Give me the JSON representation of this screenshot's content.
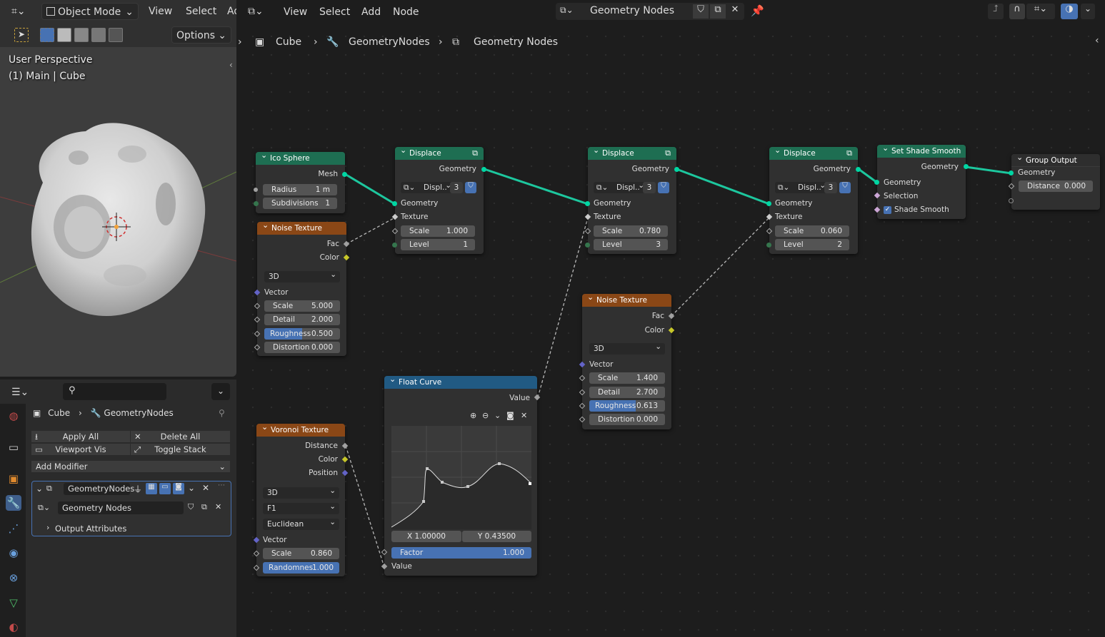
{
  "viewport": {
    "mode": "Object Mode",
    "menu": [
      "View",
      "Select",
      "Ad"
    ],
    "options": "Options",
    "perspective": "User Perspective",
    "object": "(1) Main | Cube"
  },
  "properties": {
    "breadcrumb": [
      "Cube",
      "GeometryNodes"
    ],
    "apply_all": "Apply All",
    "delete_all": "Delete All",
    "viewport_vis": "Viewport Vis",
    "toggle_stack": "Toggle Stack",
    "add_modifier": "Add Modifier",
    "modifier_name": "GeometryNodes",
    "node_group": "Geometry Nodes",
    "output_attributes": "Output Attributes"
  },
  "editor": {
    "menu": [
      "View",
      "Select",
      "Add",
      "Node"
    ],
    "node_group": "Geometry Nodes",
    "breadcrumb": [
      "Cube",
      "GeometryNodes",
      "Geometry Nodes"
    ]
  },
  "nodes": {
    "ico": {
      "title": "Ico Sphere",
      "mesh": "Mesh",
      "radius_l": "Radius",
      "radius_v": "1 m",
      "subdiv_l": "Subdivisions",
      "subdiv_v": "1"
    },
    "noise1": {
      "title": "Noise Texture",
      "fac": "Fac",
      "color": "Color",
      "dim": "3D",
      "vector": "Vector",
      "scale_l": "Scale",
      "scale_v": "5.000",
      "detail_l": "Detail",
      "detail_v": "2.000",
      "rough_l": "Roughness",
      "rough_v": "0.500",
      "dist_l": "Distortion",
      "dist_v": "0.000"
    },
    "disp1": {
      "title": "Displace",
      "geo_out": "Geometry",
      "name": "Displ..",
      "users": "3",
      "geo_in": "Geometry",
      "tex": "Texture",
      "scale_l": "Scale",
      "scale_v": "1.000",
      "level_l": "Level",
      "level_v": "1"
    },
    "disp2": {
      "title": "Displace",
      "geo_out": "Geometry",
      "name": "Displ..",
      "users": "3",
      "geo_in": "Geometry",
      "tex": "Texture",
      "scale_l": "Scale",
      "scale_v": "0.780",
      "level_l": "Level",
      "level_v": "3"
    },
    "disp3": {
      "title": "Displace",
      "geo_out": "Geometry",
      "name": "Displ..",
      "users": "3",
      "geo_in": "Geometry",
      "tex": "Texture",
      "scale_l": "Scale",
      "scale_v": "0.060",
      "level_l": "Level",
      "level_v": "2"
    },
    "smooth": {
      "title": "Set Shade Smooth",
      "geo_out": "Geometry",
      "geo_in": "Geometry",
      "selection": "Selection",
      "shade": "Shade Smooth"
    },
    "group_out": {
      "title": "Group Output",
      "geo": "Geometry",
      "dist_l": "Distance",
      "dist_v": "0.000"
    },
    "noise2": {
      "title": "Noise Texture",
      "fac": "Fac",
      "color": "Color",
      "dim": "3D",
      "vector": "Vector",
      "scale_l": "Scale",
      "scale_v": "1.400",
      "detail_l": "Detail",
      "detail_v": "2.700",
      "rough_l": "Roughness",
      "rough_v": "0.613",
      "dist_l": "Distortion",
      "dist_v": "0.000"
    },
    "curve": {
      "title": "Float Curve",
      "value_out": "Value",
      "x": "X 1.00000",
      "y": "Y 0.43500",
      "factor_l": "Factor",
      "factor_v": "1.000",
      "value_in": "Value"
    },
    "voronoi": {
      "title": "Voronoi Texture",
      "distance": "Distance",
      "color": "Color",
      "position": "Position",
      "dim": "3D",
      "feature": "F1",
      "metric": "Euclidean",
      "vector": "Vector",
      "scale_l": "Scale",
      "scale_v": "0.860",
      "rand_l": "Randomnes",
      "rand_v": "1.000"
    }
  }
}
